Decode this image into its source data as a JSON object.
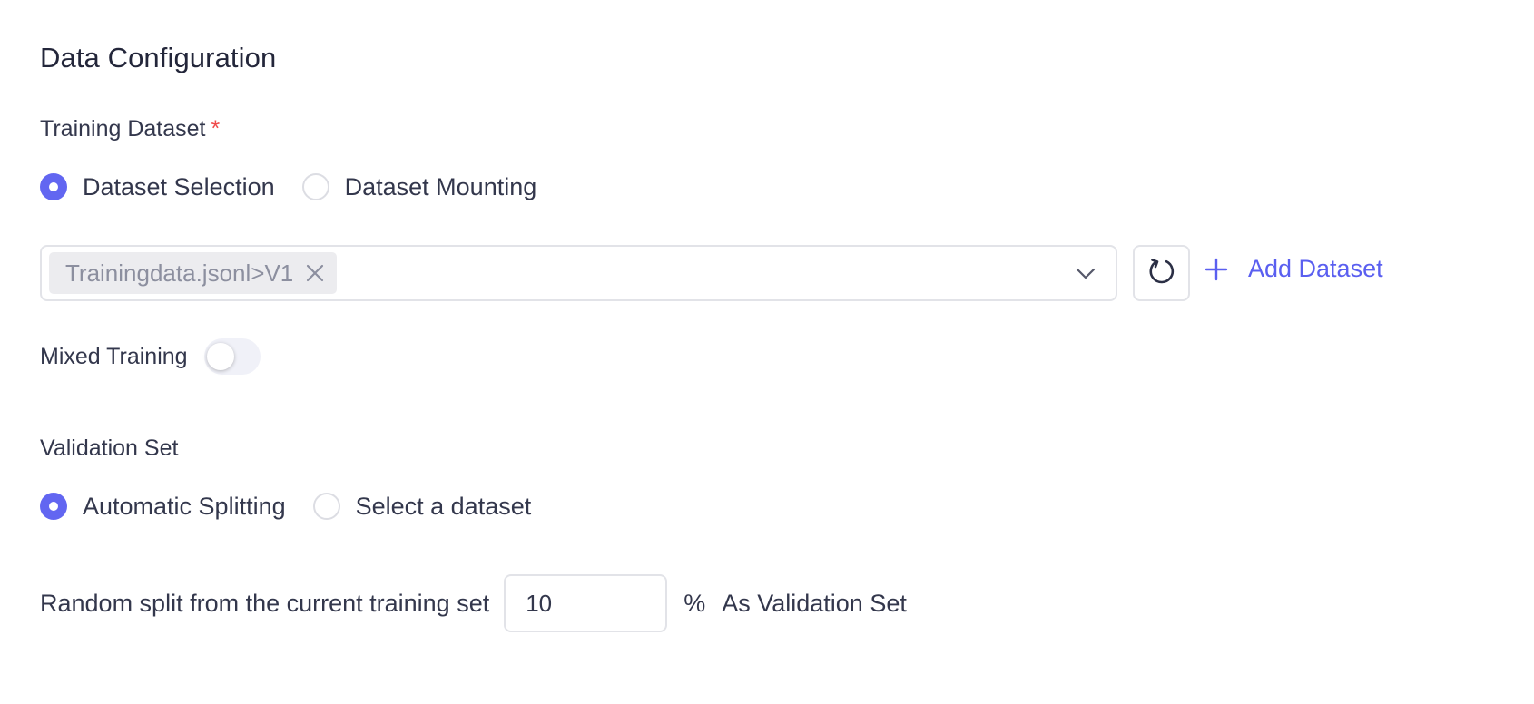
{
  "section": {
    "title": "Data Configuration"
  },
  "training": {
    "label": "Training Dataset",
    "required_mark": "*",
    "options": [
      {
        "label": "Dataset Selection",
        "checked": true
      },
      {
        "label": "Dataset Mounting",
        "checked": false
      }
    ],
    "selected_tag": "Trainingdata.jsonl>V1",
    "add_label": "Add Dataset"
  },
  "mixed": {
    "label": "Mixed Training",
    "enabled": false
  },
  "validation": {
    "label": "Validation Set",
    "options": [
      {
        "label": "Automatic Splitting",
        "checked": true
      },
      {
        "label": "Select a dataset",
        "checked": false
      }
    ],
    "split_prefix": "Random split from the current training set",
    "split_value": "10",
    "split_unit": "%",
    "split_suffix": "As Validation Set"
  },
  "icons": {
    "tag_close": "close-icon",
    "dropdown": "chevron-down-icon",
    "refresh": "refresh-icon",
    "add": "plus-icon"
  },
  "colors": {
    "accent": "#6266f1",
    "link": "#5a5ff0",
    "required": "#f04a4a"
  }
}
